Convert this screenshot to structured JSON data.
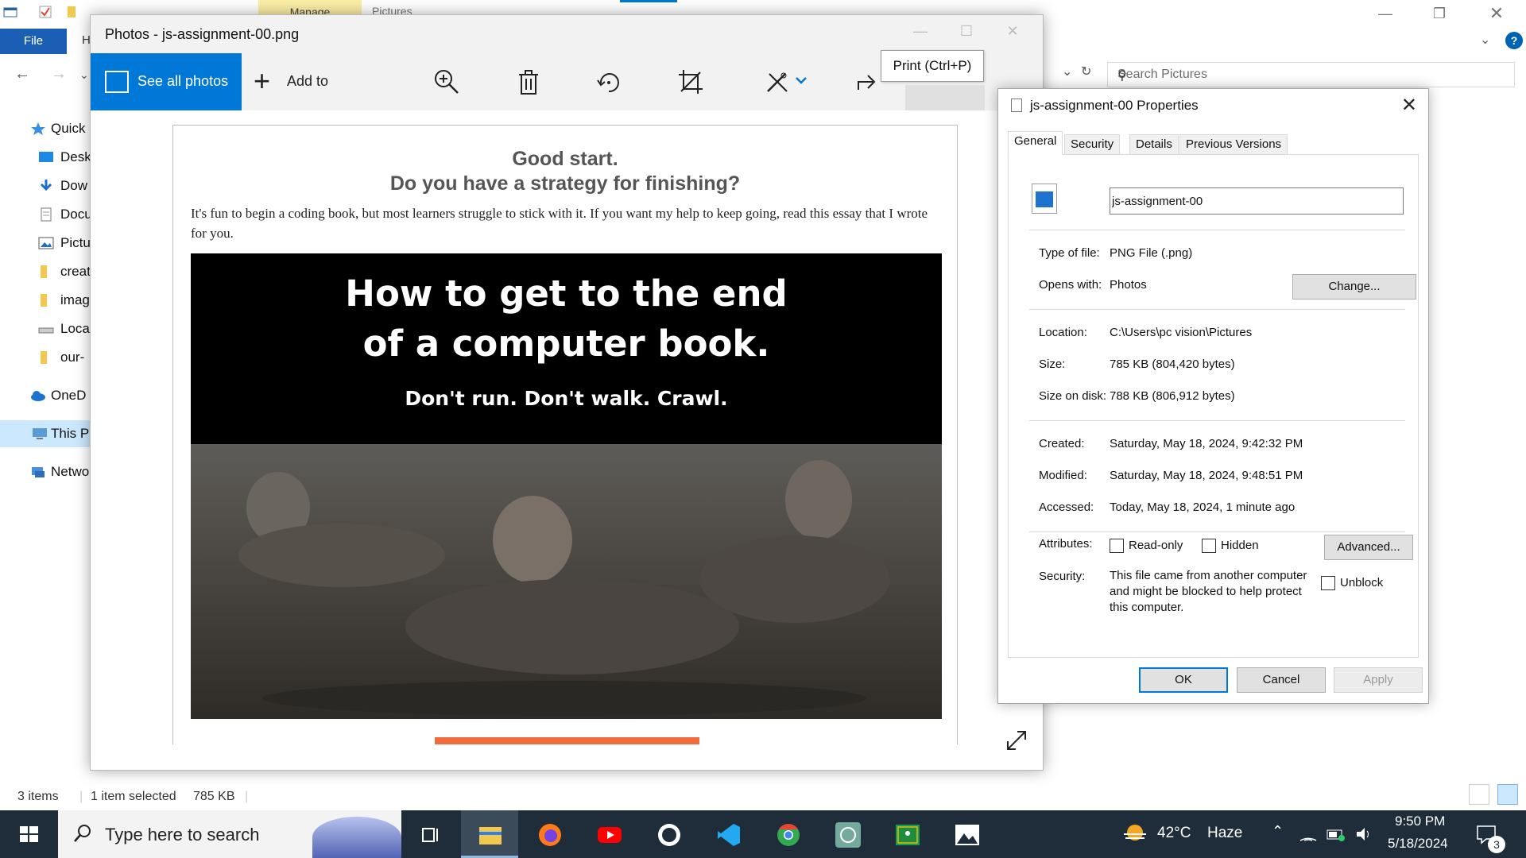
{
  "explorer": {
    "ribbon_tab_manage": "Manage",
    "window_title": "Pictures",
    "file_tab": "File",
    "home_tab_partial": "H",
    "search_placeholder": "Search Pictures",
    "sidebar": [
      {
        "label": "Quick",
        "icon": "star-icon"
      },
      {
        "label": "Desk",
        "icon": "desktop-icon"
      },
      {
        "label": "Dow",
        "icon": "download-icon"
      },
      {
        "label": "Docu",
        "icon": "document-icon"
      },
      {
        "label": "Pictu",
        "icon": "pictures-icon"
      },
      {
        "label": "creat",
        "icon": "folder-icon"
      },
      {
        "label": "imag",
        "icon": "folder-icon"
      },
      {
        "label": "Loca",
        "icon": "drive-icon"
      },
      {
        "label": "our-",
        "icon": "folder-icon"
      },
      {
        "label": "OneD",
        "icon": "onedrive-icon"
      },
      {
        "label": "This P",
        "icon": "computer-icon"
      },
      {
        "label": "Netwo",
        "icon": "network-icon"
      }
    ],
    "status": {
      "items": "3 items",
      "selected": "1 item selected",
      "size": "785 KB"
    }
  },
  "photos": {
    "title": "Photos - js-assignment-00.png",
    "see_all_photos": "See all photos",
    "add_to": "Add to",
    "tooltip": "Print (Ctrl+P)",
    "more": "...",
    "image": {
      "heading1": "Good start.",
      "heading2": "Do you have a strategy for finishing?",
      "paragraph": "It's fun to begin a coding book, but most learners struggle to stick with it. If you want my help to keep going, read this essay that I wrote for you.",
      "banner_line1": "How to get to the end",
      "banner_line2": "of a computer book.",
      "banner_line3": "Don't run. Don't walk. Crawl."
    }
  },
  "properties": {
    "title": "js-assignment-00 Properties",
    "tabs": [
      "General",
      "Security",
      "Details",
      "Previous Versions"
    ],
    "file_name": "js-assignment-00",
    "type_label": "Type of file:",
    "type_value": "PNG File (.png)",
    "opens_label": "Opens with:",
    "opens_value": "Photos",
    "change_button": "Change...",
    "location_label": "Location:",
    "location_value": "C:\\Users\\pc vision\\Pictures",
    "size_label": "Size:",
    "size_value": "785 KB (804,420 bytes)",
    "size_disk_label": "Size on disk:",
    "size_disk_value": "788 KB (806,912 bytes)",
    "created_label": "Created:",
    "created_value": "Saturday, May 18, 2024, 9:42:32 PM",
    "modified_label": "Modified:",
    "modified_value": "Saturday, May 18, 2024, 9:48:51 PM",
    "accessed_label": "Accessed:",
    "accessed_value": "Today, May 18, 2024, 1 minute ago",
    "attributes_label": "Attributes:",
    "readonly_label": "Read-only",
    "hidden_label": "Hidden",
    "advanced_button": "Advanced...",
    "security_label": "Security:",
    "security_text": "This file came from another computer and might be blocked to help protect this computer.",
    "unblock_label": "Unblock",
    "ok": "OK",
    "cancel": "Cancel",
    "apply": "Apply"
  },
  "taskbar": {
    "search_placeholder": "Type here to search",
    "temperature": "42°C",
    "weather": "Haze",
    "time": "9:50 PM",
    "date": "5/18/2024",
    "notifications": "3",
    "apps": [
      "task-view",
      "file-explorer",
      "firefox",
      "youtube",
      "github",
      "vscode",
      "chrome",
      "chatgpt",
      "google-classroom",
      "photos"
    ]
  },
  "colors": {
    "accent": "#0078d7",
    "taskbar": "#1f2d3a",
    "orange": "#f26b3f"
  }
}
